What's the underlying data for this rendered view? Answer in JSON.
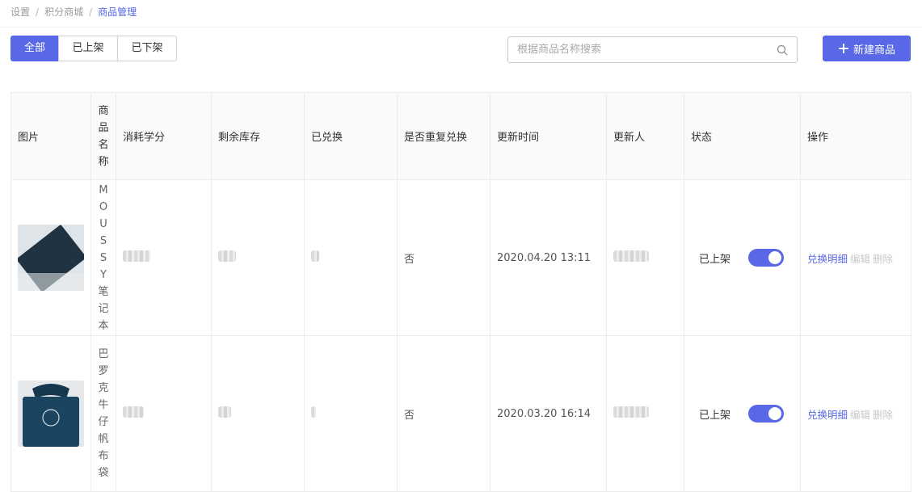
{
  "breadcrumb": {
    "items": [
      "设置",
      "积分商城"
    ],
    "separator": "/",
    "current": "商品管理"
  },
  "tabs": [
    "全部",
    "已上架",
    "已下架"
  ],
  "search": {
    "placeholder": "根据商品名称搜索",
    "value": ""
  },
  "new_button": {
    "label": "新建商品"
  },
  "table": {
    "headers": [
      "图片",
      "商品名称",
      "消耗学分",
      "剩余库存",
      "已兑换",
      "是否重复兑换",
      "更新时间",
      "更新人",
      "状态",
      "操作"
    ],
    "rows": [
      {
        "name": "MOUSSY笔记本",
        "repeatable": "否",
        "updated_at": "2020.04.20 13:11",
        "status": "已上架",
        "toggle_on": true,
        "actions": [
          "兑换明细",
          "编辑",
          "删除"
        ]
      },
      {
        "name": "巴罗克牛仔帆布袋",
        "repeatable": "否",
        "updated_at": "2020.03.20 16:14",
        "status": "已上架",
        "toggle_on": true,
        "actions": [
          "兑换明细",
          "编辑",
          "删除"
        ]
      }
    ]
  },
  "colors": {
    "accent": "#5868e6",
    "border": "#ececec",
    "header_bg": "#fafafa",
    "muted": "#c8c8c8"
  },
  "icons": {
    "search": "search-icon",
    "add": "plus-icon"
  }
}
